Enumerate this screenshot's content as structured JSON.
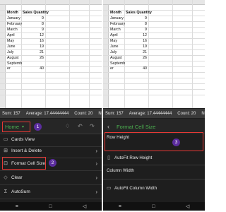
{
  "sheet": {
    "header": {
      "month": "Month",
      "sales": "Sales Quantity"
    },
    "rows": [
      {
        "month": "January",
        "qty": "9"
      },
      {
        "month": "February",
        "qty": "8"
      },
      {
        "month": "March",
        "qty": "9"
      },
      {
        "month": "April",
        "qty": "12"
      },
      {
        "month": "May",
        "qty": "16"
      },
      {
        "month": "June",
        "qty": "19"
      },
      {
        "month": "July",
        "qty": "21"
      },
      {
        "month": "August",
        "qty": "26"
      }
    ],
    "last_row": {
      "month_line1": "Septemb",
      "month_line2": "er",
      "qty": "40"
    }
  },
  "status": {
    "sum": "Sum: 157",
    "average": "Average: 17.44444444",
    "count": "Count: 20",
    "extra": "Nu"
  },
  "left_menu": {
    "home_tab": "Home",
    "badge1": "1",
    "badge2": "2",
    "items": [
      {
        "label": "Cards View",
        "icon": "cards-icon"
      },
      {
        "label": "Insert & Delete",
        "icon": "insert-delete-icon"
      },
      {
        "label": "Format Cell Size",
        "icon": "format-cell-size-icon"
      },
      {
        "label": "Clear",
        "icon": "eraser-icon"
      },
      {
        "label": "AutoSum",
        "icon": "sigma-icon"
      }
    ]
  },
  "right_menu": {
    "title": "Format Cell Size",
    "badge3": "3",
    "row_height_label": "Row Height",
    "autofit_row_height": "AutoFit Row Height",
    "column_width_label": "Column Width",
    "autofit_column_width": "AutoFit Column Width"
  },
  "navbar": {
    "menu": "≡",
    "home": "□",
    "back": "◁"
  },
  "colors": {
    "accent_green": "#4caf50",
    "highlight_red": "#e53935",
    "badge_purple": "#5b2d9e"
  }
}
